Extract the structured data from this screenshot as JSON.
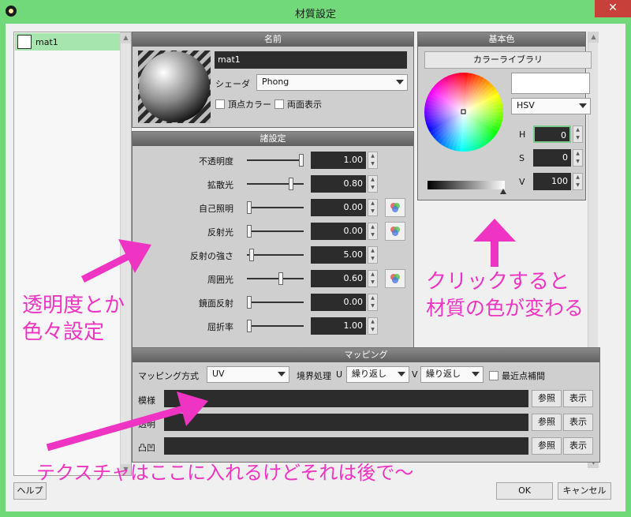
{
  "window": {
    "title": "材質設定",
    "close_glyph": "✕"
  },
  "material_list": {
    "items": [
      {
        "label": "mat1"
      }
    ],
    "scroll_up": "▲",
    "scroll_down": "▼"
  },
  "name_panel": {
    "title": "名前",
    "name_value": "mat1",
    "shader_label": "シェーダ",
    "shader_value": "Phong",
    "vertex_color_label": "頂点カラー",
    "double_sided_label": "両面表示"
  },
  "settings_panel": {
    "title": "諸設定",
    "rows": [
      {
        "label": "不透明度",
        "value": "1.00",
        "level": 1.0,
        "has_color_button": false
      },
      {
        "label": "拡散光",
        "value": "0.80",
        "level": 0.8,
        "has_color_button": false
      },
      {
        "label": "自己照明",
        "value": "0.00",
        "level": 0.0,
        "has_color_button": true
      },
      {
        "label": "反射光",
        "value": "0.00",
        "level": 0.0,
        "has_color_button": true
      },
      {
        "label": "反射の強さ",
        "value": "5.00",
        "level": 0.05,
        "has_color_button": false
      },
      {
        "label": "周囲光",
        "value": "0.60",
        "level": 0.6,
        "has_color_button": true
      },
      {
        "label": "鏡面反射",
        "value": "0.00",
        "level": 0.0,
        "has_color_button": false
      },
      {
        "label": "屈折率",
        "value": "1.00",
        "level": 0.0,
        "has_color_button": false
      }
    ]
  },
  "base_color_panel": {
    "title": "基本色",
    "library_button": "カラーライブラリ",
    "color_mode": "HSV",
    "preview_color": "#ffffff",
    "channels": [
      {
        "label": "H",
        "value": "0"
      },
      {
        "label": "S",
        "value": "0"
      },
      {
        "label": "V",
        "value": "100"
      }
    ]
  },
  "mapping_panel": {
    "title": "マッピング",
    "method_label": "マッピング方式",
    "method_value": "UV",
    "boundary_label": "境界処理",
    "u_label": "U",
    "u_value": "繰り返し",
    "v_label": "V",
    "v_value": "繰り返し",
    "nearest_label": "最近点補間",
    "rows": [
      {
        "label": "模様",
        "ref_button": "参照",
        "show_button": "表示"
      },
      {
        "label": "透明",
        "ref_button": "参照",
        "show_button": "表示"
      },
      {
        "label": "凸凹",
        "ref_button": "参照",
        "show_button": "表示"
      }
    ]
  },
  "footer": {
    "help_button": "ヘルプ",
    "ok_button": "OK",
    "cancel_button": "キャンセル"
  },
  "annotations": {
    "settings_line1": "透明度とか",
    "settings_line2": "色々設定",
    "color_line1": "クリックすると",
    "color_line2": "材質の色が変わる",
    "texture_line": "テクスチャはここに入れるけどそれは後で～"
  },
  "colors": {
    "annotation": "#ef33c2",
    "titlebar": "#72d97a",
    "selected_item": "#a6e6ae",
    "close_button": "#c7413a"
  }
}
